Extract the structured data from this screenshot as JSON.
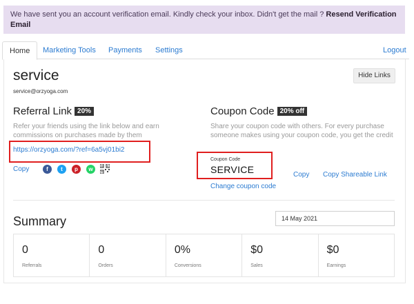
{
  "banner": {
    "text": "We have sent you an account verification email. Kindly check your inbox. Didn't get the mail ?",
    "link": "Resend Verification Email"
  },
  "tabs": [
    {
      "label": "Home",
      "active": true
    },
    {
      "label": "Marketing Tools",
      "active": false
    },
    {
      "label": "Payments",
      "active": false
    },
    {
      "label": "Settings",
      "active": false
    }
  ],
  "logout": "Logout",
  "account": {
    "name": "service",
    "email": "service@orzyoga.com",
    "hide_links": "Hide Links"
  },
  "referral": {
    "title": "Referral Link",
    "badge": "20%",
    "description": "Refer your friends using the link below and earn commissions on purchases made by them",
    "url": "https://orzyoga.com/?ref=6a5vj01bi2",
    "copy": "Copy",
    "share_icons": [
      {
        "name": "facebook-icon",
        "glyph": "f",
        "color": "#3b5998"
      },
      {
        "name": "twitter-icon",
        "glyph": "t",
        "color": "#1da1f2"
      },
      {
        "name": "pinterest-icon",
        "glyph": "p",
        "color": "#cb2027"
      },
      {
        "name": "whatsapp-icon",
        "glyph": "w",
        "color": "#25d366"
      }
    ]
  },
  "coupon": {
    "title": "Coupon Code",
    "badge": "20% off",
    "description": "Share your coupon code with others. For every purchase someone makes using your coupon code, you get the credit",
    "label": "Coupon Code",
    "code": "SERVICE",
    "copy": "Copy",
    "copy_shareable": "Copy Shareable Link",
    "change": "Change coupon code"
  },
  "summary": {
    "title": "Summary",
    "date": "14 May 2021",
    "stats": [
      {
        "value": "0",
        "label": "Referrals"
      },
      {
        "value": "0",
        "label": "Orders"
      },
      {
        "value": "0%",
        "label": "Conversions"
      },
      {
        "value": "$0",
        "label": "Sales"
      },
      {
        "value": "$0",
        "label": "Earnings"
      }
    ]
  },
  "colors": {
    "banner_bg": "#e7ddf0",
    "link": "#2b7bd1",
    "highlight_border": "#e01e1e"
  }
}
